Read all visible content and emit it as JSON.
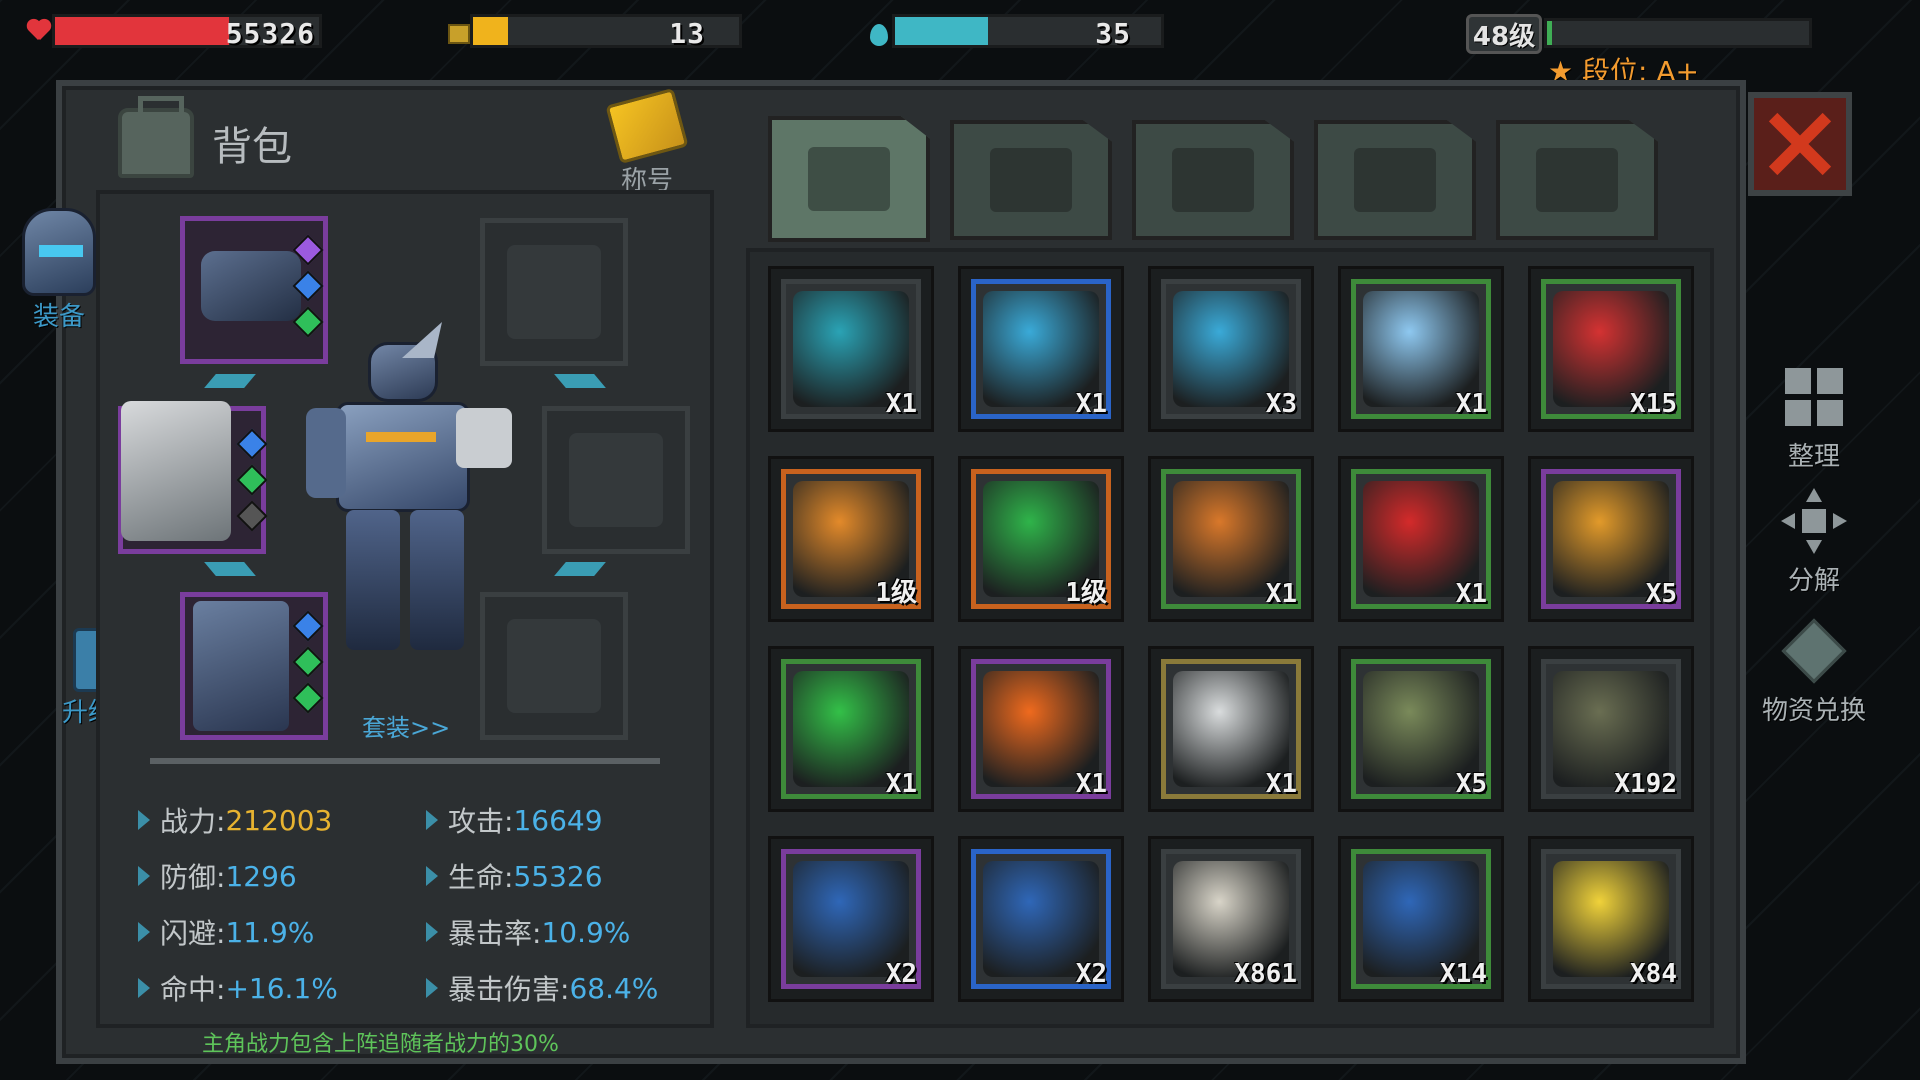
{
  "hud": {
    "hp": {
      "value": "55326",
      "fill": 0.66,
      "color": "#e2353c"
    },
    "energy": {
      "value": "13",
      "fill": 0.13,
      "color": "#f0b31c"
    },
    "water": {
      "value": "35",
      "fill": 0.35,
      "color": "#3fb7c5"
    },
    "level": "48级",
    "level_fill": 0.02,
    "rank": "★ 段位: A+"
  },
  "bag": {
    "title": "背包",
    "title_badge": "称号",
    "suit_link": "套装>>",
    "footer_note": "主角战力包含上阵追随者战力的30%"
  },
  "side": {
    "equip": "装备",
    "upgrade": "升级大师"
  },
  "stats": [
    {
      "label": "战力: ",
      "value": "212003"
    },
    {
      "label": "攻击: ",
      "value": "16649"
    },
    {
      "label": "防御: ",
      "value": "1296"
    },
    {
      "label": "生命: ",
      "value": "55326"
    },
    {
      "label": "闪避: ",
      "value": "11.9%"
    },
    {
      "label": "暴击率: ",
      "value": "10.9%"
    },
    {
      "label": "命中: ",
      "value": "+16.1%"
    },
    {
      "label": "暴击伤害: ",
      "value": "68.4%"
    }
  ],
  "tabs": [
    {
      "icon": "backpack-icon",
      "active": true
    },
    {
      "icon": "medkit-icon"
    },
    {
      "icon": "wing-armor-icon"
    },
    {
      "icon": "pistol-icon"
    },
    {
      "icon": "wrench-icon"
    }
  ],
  "items": [
    {
      "icon": "glove-badge-icon",
      "count": "X1",
      "border": "#3a3f41",
      "color": "#2aa3b5"
    },
    {
      "icon": "blue-module-icon",
      "count": "X1",
      "border": "#2a64c8",
      "color": "#3aaad8"
    },
    {
      "icon": "blue-module-icon",
      "count": "X3",
      "border": "#3a3f41",
      "color": "#3aaad8"
    },
    {
      "icon": "ice-crystal-icon",
      "count": "X1",
      "border": "#3e8a3a",
      "color": "#8ec8f0"
    },
    {
      "icon": "red-medkit-icon",
      "count": "X15",
      "border": "#3e8a3a",
      "color": "#d43232"
    },
    {
      "icon": "orange-core-icon",
      "count": "1级",
      "border": "#c8621e",
      "color": "#e38a2a"
    },
    {
      "icon": "fist-core-icon",
      "count": "1级",
      "border": "#c8621e",
      "color": "#2fb44a"
    },
    {
      "icon": "orange-monitor-icon",
      "count": "X1",
      "border": "#3e8a3a",
      "color": "#d9782a"
    },
    {
      "icon": "heart-monitor-icon",
      "count": "X1",
      "border": "#3e8a3a",
      "color": "#d42a2a"
    },
    {
      "icon": "fox-medal-icon",
      "count": "X5",
      "border": "#7a3d9d",
      "color": "#e29a2a"
    },
    {
      "icon": "green-gem-icon",
      "count": "X1",
      "border": "#3e8a3a",
      "color": "#33c048"
    },
    {
      "icon": "fire-capsule-icon",
      "count": "X1",
      "border": "#7a3d9d",
      "color": "#ef6a1e"
    },
    {
      "icon": "download-device-icon",
      "count": "X1",
      "border": "#8a7a3a",
      "color": "#d9dcdd"
    },
    {
      "icon": "green-supply-crate-icon",
      "count": "X5",
      "border": "#3e8a3a",
      "color": "#7a8a5a"
    },
    {
      "icon": "supply-bag-icon",
      "count": "X192",
      "border": "#3a3f41",
      "color": "#6a6e52"
    },
    {
      "icon": "blue-chip-icon",
      "count": "X2",
      "border": "#7a3d9d",
      "color": "#2f67b8"
    },
    {
      "icon": "blue-chip-icon",
      "count": "X2",
      "border": "#2a64c8",
      "color": "#2f67b8"
    },
    {
      "icon": "bandage-roll-icon",
      "count": "X861",
      "border": "#3a3f41",
      "color": "#d8d4c8"
    },
    {
      "icon": "blue-chip-icon",
      "count": "X14",
      "border": "#3e8a3a",
      "color": "#2f67b8"
    },
    {
      "icon": "chips-bag-icon",
      "count": "X84",
      "border": "#3a3f41",
      "color": "#f0d23a"
    }
  ],
  "right": {
    "sort": "整理",
    "decompose": "分解",
    "exchange": "物资兑换"
  }
}
